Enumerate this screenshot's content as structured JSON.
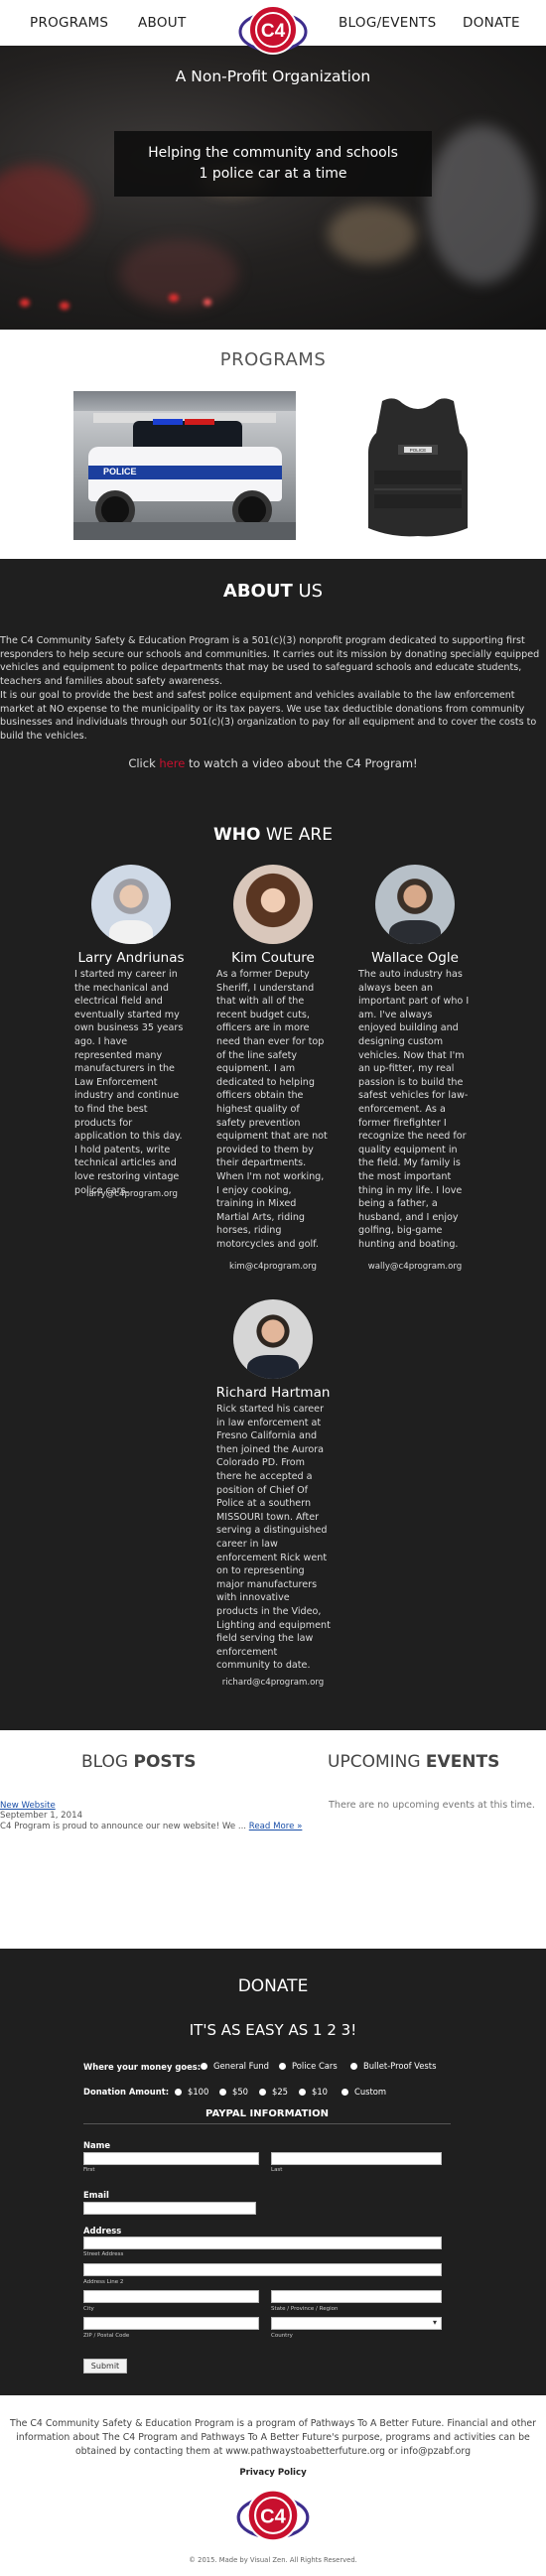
{
  "nav": {
    "programs": "PROGRAMS",
    "about": "ABOUT",
    "blog_events": "BLOG/EVENTS",
    "donate": "DONATE",
    "logo_text": "C4"
  },
  "hero": {
    "subtitle": "A Non-Profit Organization",
    "tagline_1": "Helping the community and schools",
    "tagline_2": "1 police car at a time"
  },
  "programs": {
    "title": "PROGRAMS",
    "car_label": "POLICE",
    "vest_label": "POLICE"
  },
  "about": {
    "title_bold": "ABOUT",
    "title_light": " US",
    "p1": "The C4 Community Safety & Education Program is a 501(c)(3) nonprofit program dedicated to supporting first responders to help secure our schools and communities. It carries out its mission by donating specially equipped vehicles and equipment to police departments that may be used to safeguard schools and educate students, teachers and families about safety awareness.",
    "p2": "It is our goal to provide the best and safest police equipment and vehicles available to the law enforcement market at NO expense to the municipality or its tax payers. We use tax deductible donations from community businesses and individuals through our 501(c)(3) organization to pay for all equipment and to cover the costs to build the vehicles.",
    "video_pre": "Click ",
    "video_link": "here",
    "video_post": " to watch a video about the C4 Program!"
  },
  "who": {
    "title_bold": "WHO",
    "title_light": " WE ARE"
  },
  "members": [
    {
      "name": "Larry Andriunas",
      "bio": "I started my career in the mechanical and electrical field and eventually started my own business 35 years ago. I have represented many manufacturers in the Law Enforcement industry and continue to find the best products for application to this day. I hold patents, write technical articles and love restoring vintage police cars.",
      "email": "larry@c4program.org"
    },
    {
      "name": "Kim Couture",
      "bio": "As a former Deputy Sheriff, I understand that with all of the recent budget cuts, officers are in more need than ever for top of the line safety equipment. I am dedicated to helping officers obtain the highest quality of safety prevention equipment that are not provided to them by their departments. When I'm not working, I enjoy cooking, training in Mixed Martial Arts, riding horses, riding motorcycles and golf.",
      "email": "kim@c4program.org"
    },
    {
      "name": "Wallace Ogle",
      "bio": "The auto industry has always been an important part of who I am. I've always enjoyed building and designing custom vehicles. Now that I'm an up-fitter, my real passion is to build the safest vehicles for law-enforcement. As a former firefighter I recognize the need for quality equipment in the field. My family is the most important thing in my life. I love being a father, a husband, and I enjoy golfing, big-game hunting and boating.",
      "email": "wally@c4program.org"
    },
    {
      "name": "Richard Hartman",
      "bio": "Rick started his career in law enforcement at Fresno California and then joined the Aurora Colorado PD. From there he accepted a position of Chief Of Police at a southern MISSOURI town. After serving a distinguished career in law enforcement Rick went on to representing major manufacturers with innovative products in the Video, Lighting and equipment field serving the law enforcement community to date.",
      "email": "richard@c4program.org"
    }
  ],
  "blog": {
    "title_light": "BLOG ",
    "title_bold": "POSTS",
    "post_title": "New Website",
    "post_date": "September 1, 2014",
    "post_excerpt": "C4 Program is proud to announce our new website! We ...",
    "read_more": "Read More »"
  },
  "events": {
    "title_light": "UPCOMING ",
    "title_bold": "EVENTS",
    "empty": "There are no upcoming events at this time."
  },
  "donate": {
    "title": "DONATE",
    "slogan": "IT'S AS EASY AS 1 2 3!",
    "where_label": "Where your money goes:",
    "where_options": [
      "General Fund",
      "Police Cars",
      "Bullet-Proof Vests"
    ],
    "amount_label": "Donation Amount:",
    "amount_options": [
      "$100",
      "$50",
      "$25",
      "$10",
      "Custom"
    ],
    "paypal_title": "PAYPAL INFORMATION",
    "name_label": "Name",
    "first": "First",
    "last": "Last",
    "email_label": "Email",
    "address_label": "Address",
    "street": "Street Address",
    "line2": "Address Line 2",
    "city": "City",
    "state": "State / Province / Region",
    "zip": "ZIP / Postal Code",
    "country": "Country",
    "submit": "Submit"
  },
  "footer": {
    "text": "The C4 Community Safety & Education Program is a program of Pathways To A Better Future. Financial and other information about The C4 Program and Pathways To A Better Future's purpose, programs and activities can be obtained by contacting them at www.pathwaystoabetterfuture.org or info@pzabf.org",
    "privacy": "Privacy Policy",
    "copyright": "© 2015. Made by Visual Zen. All Rights Reserved."
  },
  "colors": {
    "dark_bg": "#1f1f1f",
    "accent_red": "#c8102e",
    "link_blue": "#1a4fa8",
    "logo_purple": "#3d2d8c"
  }
}
